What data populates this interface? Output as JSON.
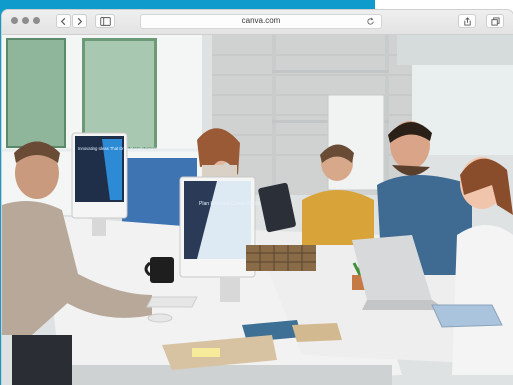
{
  "browser": {
    "url": "canva.com"
  },
  "icons": {
    "window_dots": [
      "close-dot",
      "minimize-dot",
      "zoom-dot"
    ],
    "back": "chevron-left-icon",
    "forward": "chevron-right-icon",
    "sidebar": "sidebar-icon",
    "reload": "reload-icon",
    "share": "share-icon",
    "tabs": "tabs-icon"
  },
  "colors": {
    "teal": "#0f9ccc",
    "chrome": "#e9e9e9"
  },
  "photo": {
    "monitor_text": "Innovating Ideas That Drive Results Faster",
    "monitor2_text": "Plan Innovate Create Deploy"
  }
}
